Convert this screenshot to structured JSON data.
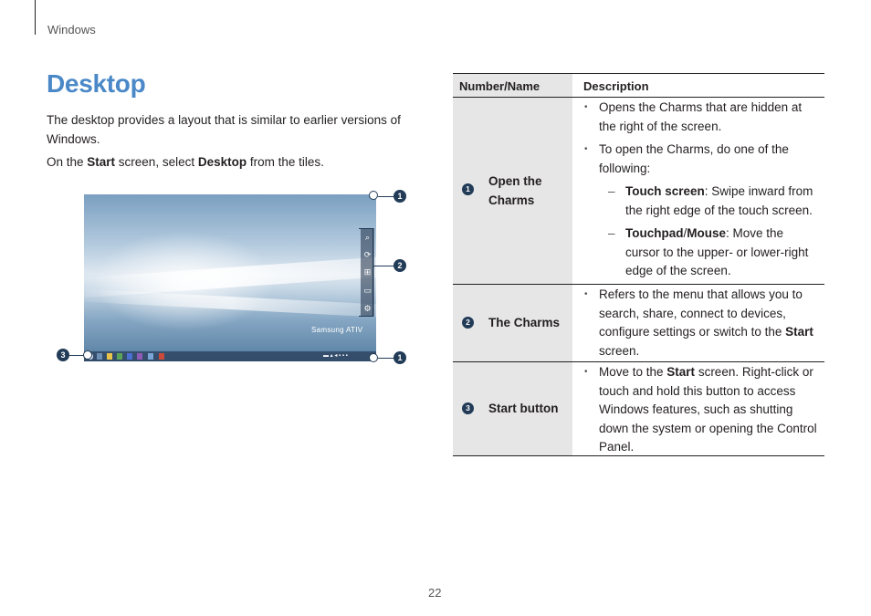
{
  "header": {
    "section": "Windows"
  },
  "title": "Desktop",
  "intro": {
    "p1": "The desktop provides a layout that is similar to earlier versions of Windows.",
    "p2_a": "On the ",
    "p2_start": "Start",
    "p2_b": " screen, select ",
    "p2_desktop": "Desktop",
    "p2_c": " from the tiles."
  },
  "figure": {
    "brand_text": "Samsung ATIV",
    "callouts": [
      "1",
      "2",
      "3",
      "1"
    ],
    "charm_icons": [
      "search-icon",
      "share-icon",
      "start-icon",
      "devices-icon",
      "settings-icon"
    ]
  },
  "table": {
    "headers": {
      "col1": "Number/Name",
      "col2": "Description"
    },
    "rows": [
      {
        "num": "1",
        "name_l1": "Open the",
        "name_l2": "Charms",
        "bullets": [
          "Opens the Charms that are hidden at the right of the screen.",
          "To open the Charms, do one of the following:"
        ],
        "sub": [
          {
            "bold": "Touch screen",
            "rest": ": Swipe inward from the right edge of the touch screen."
          },
          {
            "bold": "Touchpad",
            "slash": "/",
            "bold2": "Mouse",
            "rest": ": Move the cursor to the upper- or lower-right edge of the screen."
          }
        ]
      },
      {
        "num": "2",
        "name": "The Charms",
        "text_a": "Refers to the menu that allows you to search, share, connect to devices, configure settings or switch to the ",
        "text_bold": "Start",
        "text_b": " screen."
      },
      {
        "num": "3",
        "name": "Start button",
        "text_a": "Move to the ",
        "text_bold": "Start",
        "text_b": " screen. Right-click or touch and hold this button to access Windows features, such as shutting down the system or opening the Control Panel."
      }
    ]
  },
  "page_number": "22",
  "colors": {
    "title": "#4a88c7",
    "callout": "#223b57",
    "table_shade": "#e6e6e6"
  }
}
